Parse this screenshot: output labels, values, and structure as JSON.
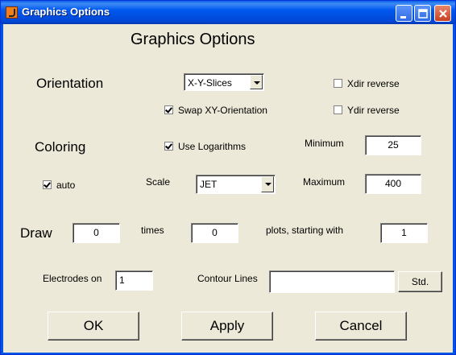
{
  "window": {
    "title": "Graphics Options"
  },
  "heading": "Graphics Options",
  "orientation": {
    "label": "Orientation",
    "selected": "X-Y-Slices",
    "swap_label": "Swap XY-Orientation",
    "swap_checked": true,
    "xdir_label": "Xdir reverse",
    "xdir_checked": false,
    "ydir_label": "Ydir reverse",
    "ydir_checked": false
  },
  "coloring": {
    "label": "Coloring",
    "log_label": "Use Logarithms",
    "log_checked": true,
    "min_label": "Minimum",
    "min_value": "25",
    "auto_label": "auto",
    "auto_checked": true,
    "scale_label": "Scale",
    "scale_selected": "JET",
    "max_label": "Maximum",
    "max_value": "400"
  },
  "draw": {
    "label": "Draw",
    "first_value": "0",
    "times_label": "times",
    "second_value": "0",
    "plots_label": "plots, starting with",
    "start_value": "1"
  },
  "electrodes": {
    "label": "Electrodes on",
    "value": "1"
  },
  "contour": {
    "label": "Contour Lines",
    "value": "",
    "std_label": "Std."
  },
  "buttons": {
    "ok": "OK",
    "apply": "Apply",
    "cancel": "Cancel"
  }
}
